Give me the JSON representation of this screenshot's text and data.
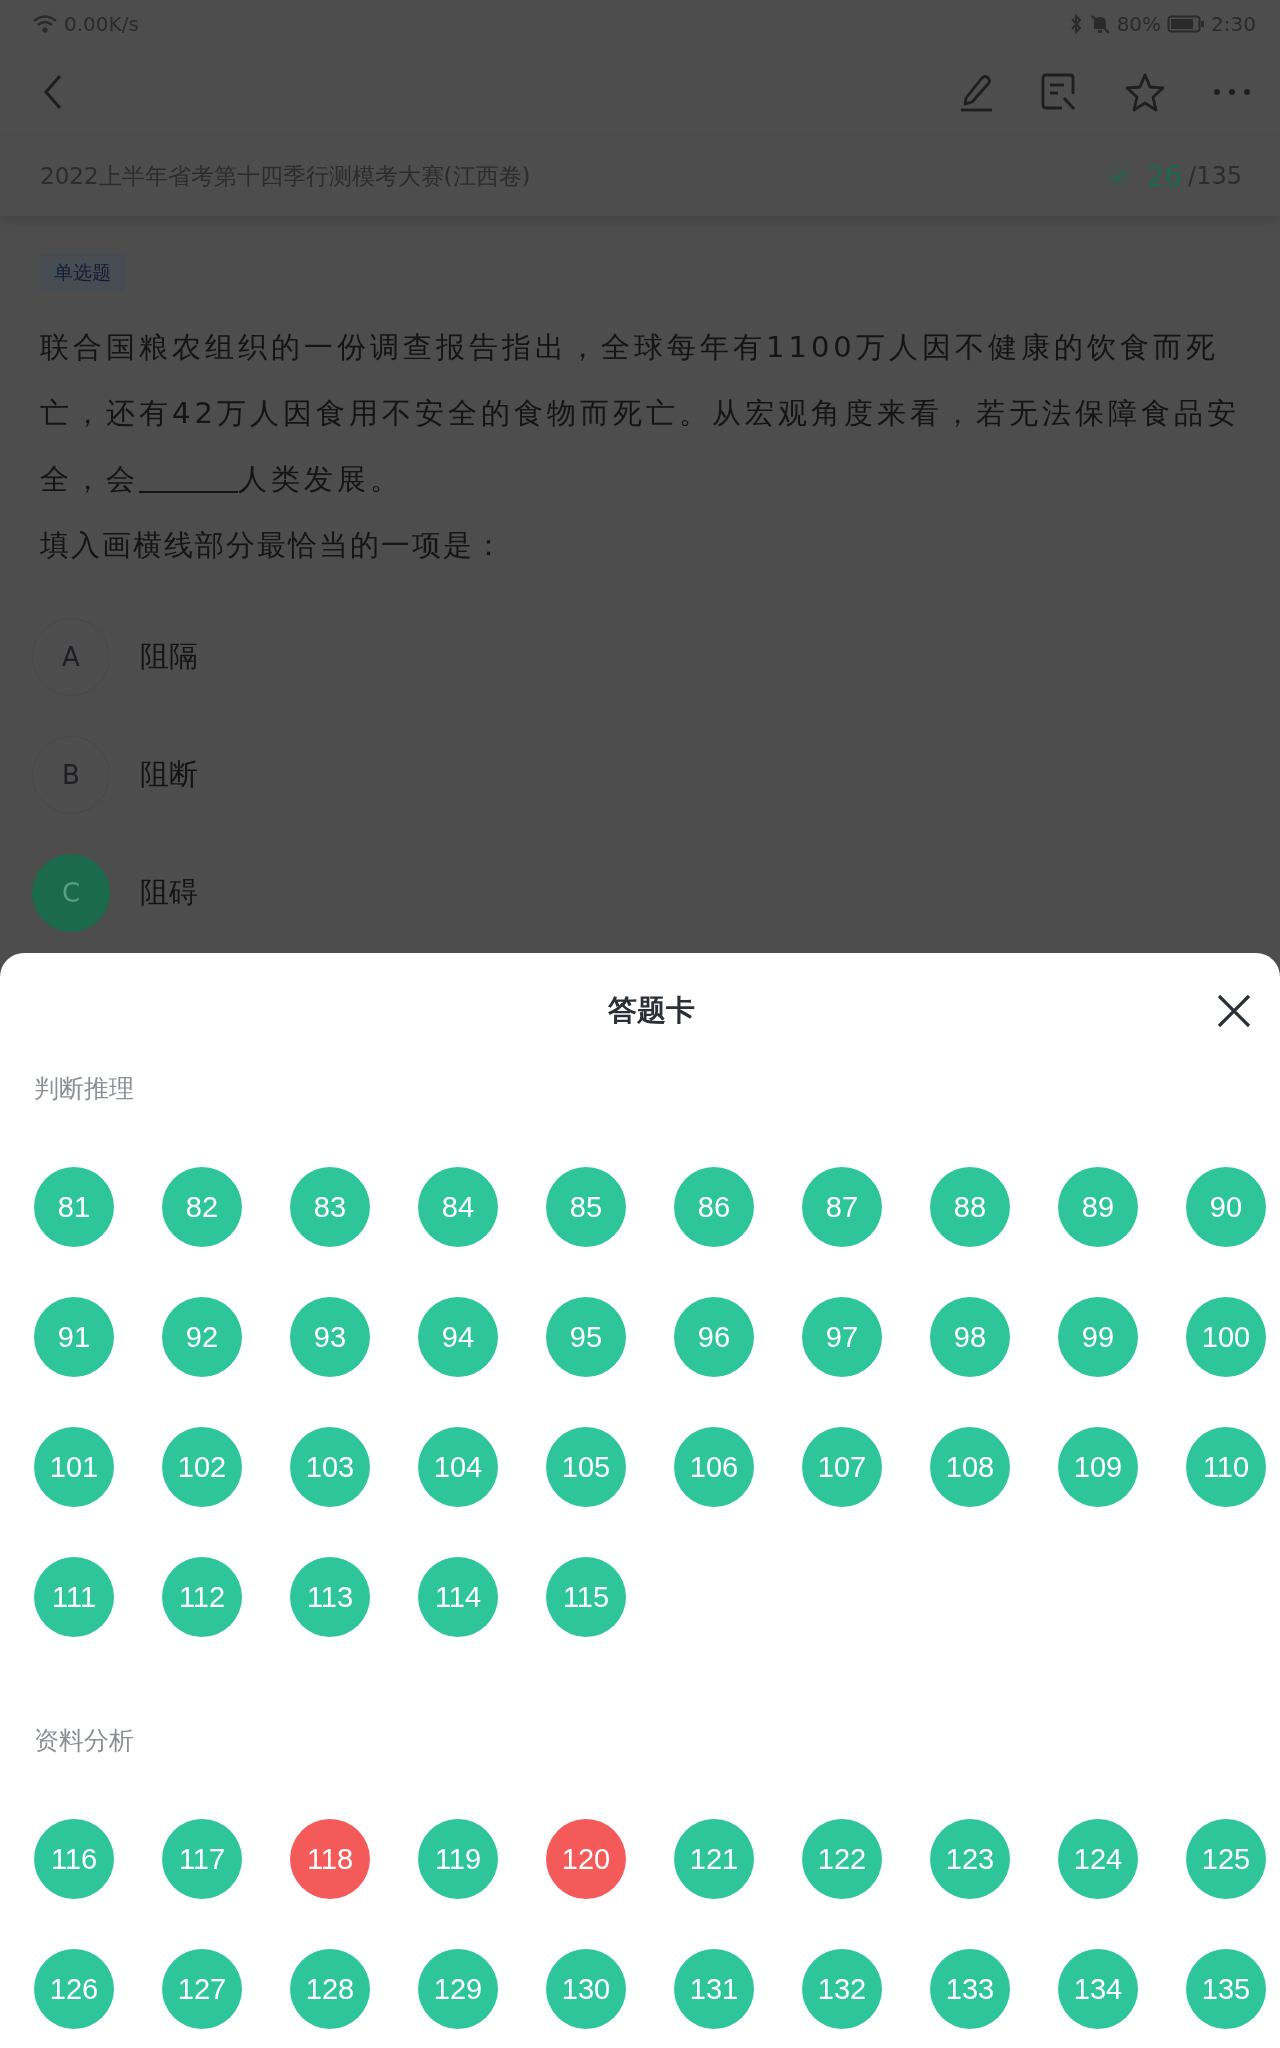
{
  "status_bar": {
    "network_speed": "0.00K/s",
    "battery": "80%",
    "time": "2:30"
  },
  "exam": {
    "title": "2022上半年省考第十四季行测模考大赛(江西卷)",
    "progress_done": "26",
    "progress_total": "/135"
  },
  "question": {
    "type_tag": "单选题",
    "text_before": "联合国粮农组织的一份调查报告指出，全球每年有1100万人因不健康的饮食而死亡，还有42万人因食用不安全的食物而死亡。从宏观角度来看，若无法保障食品安全，会",
    "blank": "＿＿＿",
    "text_after": "人类发展。",
    "prompt": "填入画横线部分最恰当的一项是："
  },
  "options": [
    {
      "letter": "A",
      "text": "阻隔",
      "selected": false
    },
    {
      "letter": "B",
      "text": "阻断",
      "selected": false
    },
    {
      "letter": "C",
      "text": "阻碍",
      "selected": true
    }
  ],
  "answer_sheet": {
    "title": "答题卡",
    "sections": [
      {
        "name": "判断推理",
        "items": [
          {
            "number": "81",
            "correct": true
          },
          {
            "number": "82",
            "correct": true
          },
          {
            "number": "83",
            "correct": true
          },
          {
            "number": "84",
            "correct": true
          },
          {
            "number": "85",
            "correct": true
          },
          {
            "number": "86",
            "correct": true
          },
          {
            "number": "87",
            "correct": true
          },
          {
            "number": "88",
            "correct": true
          },
          {
            "number": "89",
            "correct": true
          },
          {
            "number": "90",
            "correct": true
          },
          {
            "number": "91",
            "correct": true
          },
          {
            "number": "92",
            "correct": true
          },
          {
            "number": "93",
            "correct": true
          },
          {
            "number": "94",
            "correct": true
          },
          {
            "number": "95",
            "correct": true
          },
          {
            "number": "96",
            "correct": true
          },
          {
            "number": "97",
            "correct": true
          },
          {
            "number": "98",
            "correct": true
          },
          {
            "number": "99",
            "correct": true
          },
          {
            "number": "100",
            "correct": true
          },
          {
            "number": "101",
            "correct": true
          },
          {
            "number": "102",
            "correct": true
          },
          {
            "number": "103",
            "correct": true
          },
          {
            "number": "104",
            "correct": true
          },
          {
            "number": "105",
            "correct": true
          },
          {
            "number": "106",
            "correct": true
          },
          {
            "number": "107",
            "correct": true
          },
          {
            "number": "108",
            "correct": true
          },
          {
            "number": "109",
            "correct": true
          },
          {
            "number": "110",
            "correct": true
          },
          {
            "number": "111",
            "correct": true
          },
          {
            "number": "112",
            "correct": true
          },
          {
            "number": "113",
            "correct": true
          },
          {
            "number": "114",
            "correct": true
          },
          {
            "number": "115",
            "correct": true
          }
        ]
      },
      {
        "name": "资料分析",
        "items": [
          {
            "number": "116",
            "correct": true
          },
          {
            "number": "117",
            "correct": true
          },
          {
            "number": "118",
            "correct": false
          },
          {
            "number": "119",
            "correct": true
          },
          {
            "number": "120",
            "correct": false
          },
          {
            "number": "121",
            "correct": true
          },
          {
            "number": "122",
            "correct": true
          },
          {
            "number": "123",
            "correct": true
          },
          {
            "number": "124",
            "correct": true
          },
          {
            "number": "125",
            "correct": true
          },
          {
            "number": "126",
            "correct": true
          },
          {
            "number": "127",
            "correct": true
          },
          {
            "number": "128",
            "correct": true
          },
          {
            "number": "129",
            "correct": true
          },
          {
            "number": "130",
            "correct": true
          },
          {
            "number": "131",
            "correct": true
          },
          {
            "number": "132",
            "correct": true
          },
          {
            "number": "133",
            "correct": true
          },
          {
            "number": "134",
            "correct": true
          },
          {
            "number": "135",
            "correct": true
          }
        ]
      }
    ]
  }
}
